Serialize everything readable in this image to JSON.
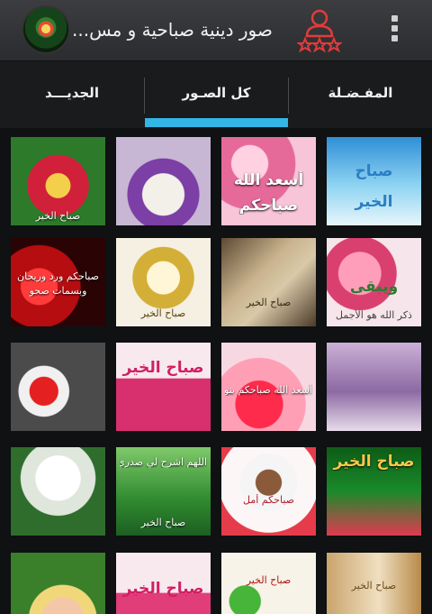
{
  "app_bar": {
    "title": "صور دينية صباحية و مس...",
    "logo_icon": "app-logo-icon",
    "profile_icon": "user-rating-icon",
    "menu_icon": "overflow-menu-icon"
  },
  "tabs": [
    {
      "label": "المفـضـلة"
    },
    {
      "label": "كل الصـور",
      "selected": true
    },
    {
      "label": "الجديـــد"
    }
  ],
  "tiles": [
    {
      "t1": "صباح",
      "t2": "الخير"
    },
    {
      "t1": "أسعد الله",
      "t2": "صباحكم"
    },
    {
      "t1": "",
      "t2": ""
    },
    {
      "t1": "",
      "t2": "صباح الخير"
    },
    {
      "t1": "ويبقى",
      "t2": "ذكر الله هو الأجمل"
    },
    {
      "t1": "",
      "t2": "صباح الخير"
    },
    {
      "t1": "",
      "t2": "صباح الخير"
    },
    {
      "t1": "صباحكم ورد وريحان",
      "t2": "وبسمات صحو"
    },
    {
      "t1": "",
      "t2": ""
    },
    {
      "t1": "أسعد الله صباحكم بنور الإيمان",
      "t2": ""
    },
    {
      "t1": "صباح الخير",
      "t2": ""
    },
    {
      "t1": "",
      "t2": ""
    },
    {
      "t1": "صباح الخير",
      "t2": ""
    },
    {
      "t1": "صباحكم أمل",
      "t2": ""
    },
    {
      "t1": "اللهم اشرح لي صدري",
      "t2": "صباح الخير"
    },
    {
      "t1": "صباح الخير",
      "t2": ""
    },
    {
      "t1": "",
      "t2": ""
    },
    {
      "t1": "صباح الخير",
      "t2": "صباح الخير"
    },
    {
      "t1": "صباح الخير",
      "t2": ""
    },
    {
      "t1": "صباح الخير",
      "t2": ""
    }
  ]
}
